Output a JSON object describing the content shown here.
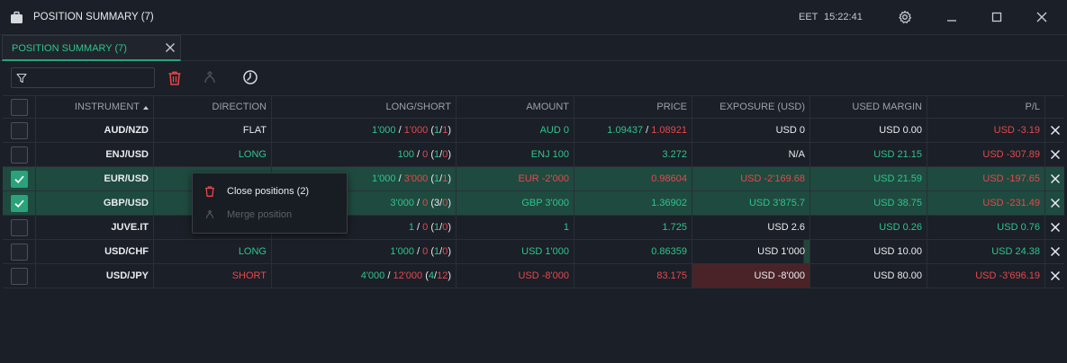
{
  "window": {
    "title": "POSITION SUMMARY (7)",
    "timezone": "EET",
    "time": "15:22:41"
  },
  "tabs": [
    {
      "label": "POSITION SUMMARY (7)"
    }
  ],
  "toolbar": {
    "filter_value": ""
  },
  "columns": {
    "instrument": "INSTRUMENT",
    "direction": "DIRECTION",
    "long_short": "LONG/SHORT",
    "amount": "AMOUNT",
    "price": "PRICE",
    "exposure": "EXPOSURE (USD)",
    "used_margin": "USED MARGIN",
    "pl": "P/L"
  },
  "rows": [
    {
      "instrument": "AUD/NZD",
      "direction": "FLAT",
      "long": "1'000",
      "short": "1'000",
      "count_long": "1",
      "count_short": "1",
      "amount": "AUD 0",
      "price_a": "1.09437",
      "price_b": "1.08921",
      "exposure": "USD 0",
      "used_margin": "USD 0.00",
      "pl": "USD -3.19"
    },
    {
      "instrument": "ENJ/USD",
      "direction": "LONG",
      "long": "100",
      "short": "0",
      "count_long": "1",
      "count_short": "0",
      "amount": "ENJ 100",
      "price_a": "3.272",
      "price_b": "",
      "exposure": "N/A",
      "used_margin": "USD 21.15",
      "pl": "USD -307.89"
    },
    {
      "instrument": "EUR/USD",
      "direction": "",
      "long": "1'000",
      "short": "3'000",
      "count_long": "1",
      "count_short": "1",
      "amount": "EUR -2'000",
      "price_a": "0.98604",
      "price_b": "",
      "exposure": "USD -2'169.68",
      "used_margin": "USD 21.59",
      "pl": "USD -197.65"
    },
    {
      "instrument": "GBP/USD",
      "direction": "",
      "long": "3'000",
      "short": "0",
      "count_long": "3",
      "count_short": "0",
      "amount": "GBP 3'000",
      "price_a": "1.36902",
      "price_b": "",
      "exposure": "USD 3'875.7",
      "used_margin": "USD 38.75",
      "pl": "USD -231.49"
    },
    {
      "instrument": "JUVE.IT",
      "direction": "",
      "long": "1",
      "short": "0",
      "count_long": "1",
      "count_short": "0",
      "amount": "1",
      "price_a": "1.725",
      "price_b": "",
      "exposure": "USD 2.6",
      "used_margin": "USD 0.26",
      "pl": "USD 0.76"
    },
    {
      "instrument": "USD/CHF",
      "direction": "LONG",
      "long": "1'000",
      "short": "0",
      "count_long": "1",
      "count_short": "0",
      "amount": "USD 1'000",
      "price_a": "0.86359",
      "price_b": "",
      "exposure": "USD 1'000",
      "used_margin": "USD 10.00",
      "pl": "USD 24.38"
    },
    {
      "instrument": "USD/JPY",
      "direction": "SHORT",
      "long": "4'000",
      "short": "12'000",
      "count_long": "4",
      "count_short": "12",
      "amount": "USD -8'000",
      "price_a": "83.175",
      "price_b": "",
      "exposure": "USD -8'000",
      "used_margin": "USD 80.00",
      "pl": "USD -3'696.19"
    }
  ],
  "context_menu": {
    "close_positions": "Close positions (2)",
    "merge_position": "Merge position"
  },
  "colors": {
    "accent": "#2aa37a",
    "positive": "#2fc48c",
    "negative": "#e5484d",
    "background": "#1b1f27",
    "selected_row": "#1f4a3f"
  }
}
